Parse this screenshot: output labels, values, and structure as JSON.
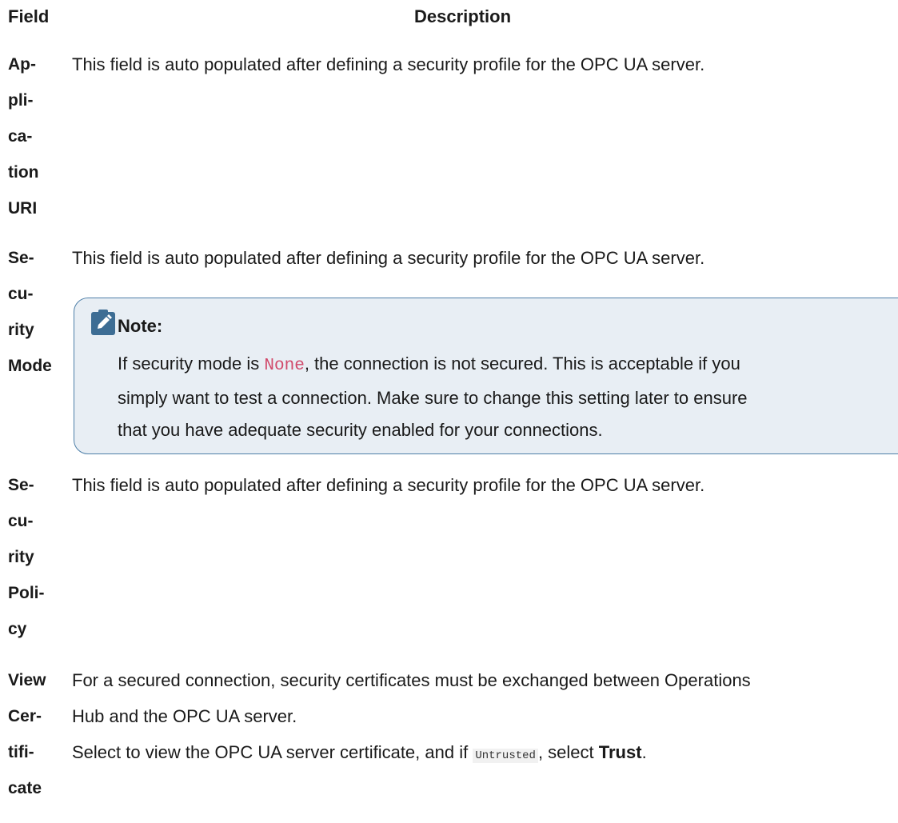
{
  "header": {
    "field": "Field",
    "description": "Description"
  },
  "rows": [
    {
      "field_lines": [
        "Ap-",
        "pli-",
        "ca-",
        "tion",
        "URI"
      ],
      "description": "This field is auto populated after defining a security profile for the OPC UA server."
    },
    {
      "field_lines": [
        "Se-",
        "cu-",
        "rity",
        "Mode"
      ],
      "description": "This field is auto populated after defining a security profile for the OPC UA server.",
      "note": {
        "title": "Note:",
        "text_before_code": "If security mode is ",
        "code": "None",
        "text_after_code": ", the connection is not secured. This is acceptable if you",
        "line2": "simply want to test a connection. Make sure to change this setting later to ensure",
        "line3": "that you have adequate security enabled for your connections.",
        "icon": "pencil-icon",
        "colors": {
          "background": "#e8eef4",
          "border": "#4e7fa8",
          "icon_bg": "#3d6d94"
        }
      }
    },
    {
      "field_lines": [
        "Se-",
        "cu-",
        "rity",
        "Poli-",
        "cy"
      ],
      "description": "This field is auto populated after defining a security profile for the OPC UA server."
    },
    {
      "field_lines": [
        "View",
        "Cer-",
        "tifi-",
        "cate"
      ],
      "description_line1": "For a secured connection, security certificates must be exchanged between Operations",
      "description_line2": "Hub and the OPC UA server.",
      "description_line3_before": "Select to view the OPC UA server certificate, and if ",
      "description_line3_code": "Untrusted",
      "description_line3_middle": ", select ",
      "description_line3_bold": "Trust",
      "description_line3_end": "."
    }
  ]
}
